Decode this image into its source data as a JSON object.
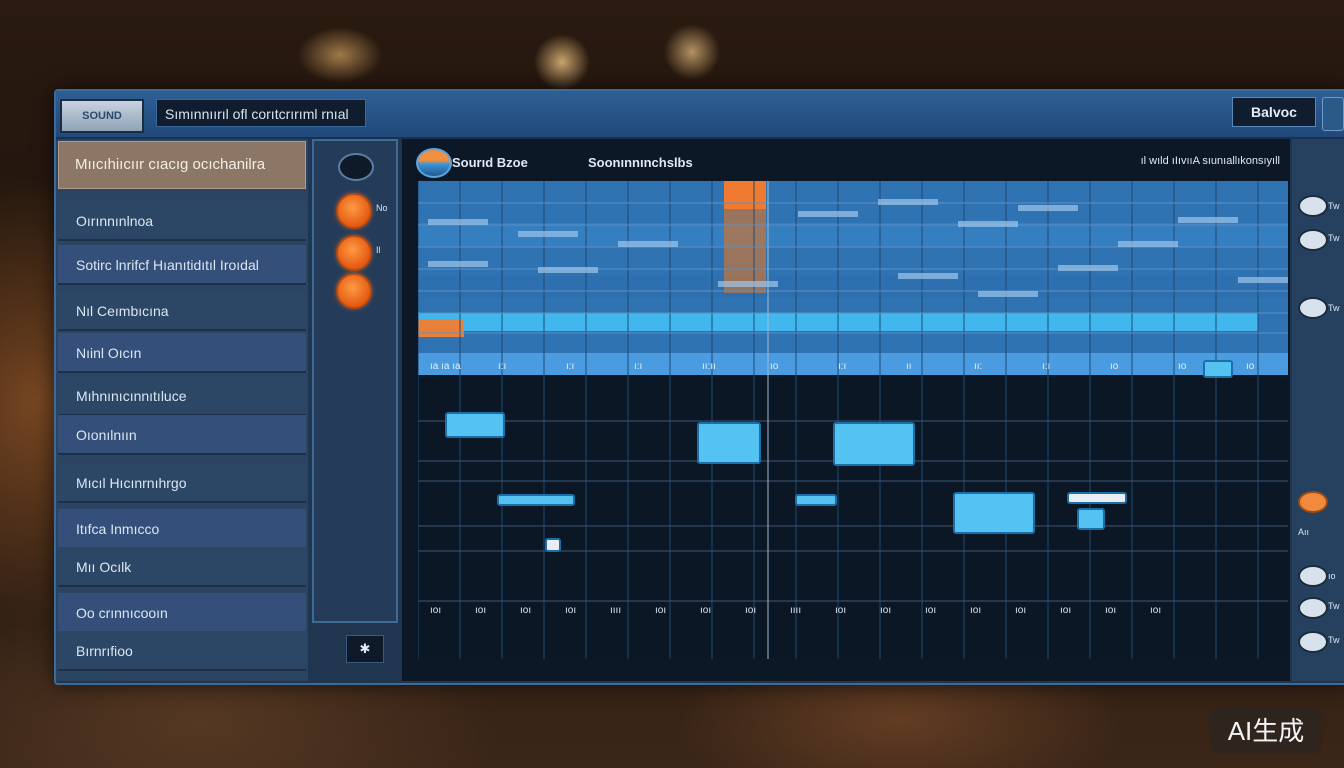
{
  "titlebar": {
    "logo_text": "SOUND",
    "app_title": "Sımınnıırıl ofl corıtcrırıml rnıal",
    "balance_label": "Balvoc"
  },
  "left_panel": {
    "header": "Mııcıhiıcıır cıacıg ocıchanilra",
    "items": [
      "Oırınnınlnoa",
      "Sotirc lnrifcf Hıanıtidıtıl Iroıdal",
      "Nıl Ceımbıcına",
      "Nıinl Oıcın",
      "Mıhnınıcınnıtıluce",
      "Oıonılnıın",
      "Mıcıl Hıcınrnıhrgo",
      "Itıfca Inmıcco",
      "Mıı Ocılk",
      "Oo crınnıcooın",
      "Bırnrıfioo"
    ]
  },
  "tools": {
    "btn_labels": [
      "No",
      "Il",
      ""
    ],
    "bottom_btn": "✱"
  },
  "main": {
    "sound_label": "Sourıd Bzoe",
    "sound_name": "Soonınnınchslbs",
    "top_right": "ıl wıld ıIıvııA sıunıallıkonsıyıll",
    "ruler_labels": [
      "ıa ıa ıa",
      "ı:ı",
      "ı:ı",
      "ı:ı",
      "ıı:ıı",
      "ıo",
      "ı:ı",
      "ıı",
      "ıı:",
      "ı:ı",
      "ıo",
      "ıo",
      "ıo"
    ],
    "bottom_labels": [
      "ıoı",
      "ıoı",
      "ıoı",
      "ıoı",
      "ıııı",
      "ıoı",
      "ıoı",
      "ıoı",
      "ıııı",
      "ıoı",
      "ıoı",
      "ıoı",
      "ıoı",
      "ıoı",
      "ıoı",
      "ıoı",
      "ıoı"
    ]
  },
  "right_panel": {
    "labels": [
      "Tw",
      "Tw",
      "Tw",
      "",
      "",
      "",
      "Aıı",
      "ıo",
      "Tw",
      "Tw"
    ]
  },
  "watermark": "AI生成",
  "colors": {
    "accent_blue": "#3d8fd6",
    "bright_blue": "#45b6ef",
    "orange": "#f08a3c",
    "panel": "#2a4462",
    "window_border": "#3d6b99"
  }
}
